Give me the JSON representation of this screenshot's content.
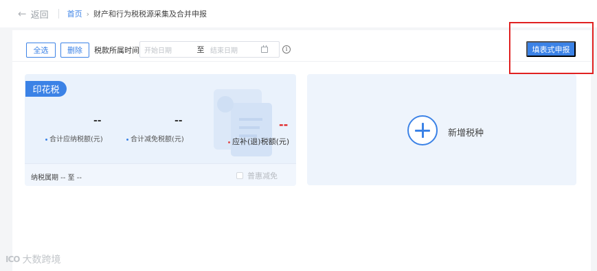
{
  "topbar": {
    "back_label": "返回",
    "breadcrumb": {
      "home": "首页",
      "separator": "›",
      "current": "财产和行为税税源采集及合并申报"
    }
  },
  "toolbar": {
    "select_all_label": "全选",
    "delete_label": "删除",
    "period_label": "税款所属时间",
    "date_start_placeholder": "开始日期",
    "date_to": "至",
    "date_end_placeholder": "结束日期",
    "info_glyph": "i",
    "fill_form_label": "填表式申报"
  },
  "tax_card": {
    "tag": "印花税",
    "stats": [
      {
        "value": "--",
        "label": "合计应纳税额(元)"
      },
      {
        "value": "--",
        "label": "合计减免税额(元)"
      },
      {
        "value": "--",
        "label": "应补(退)税额(元)"
      }
    ],
    "footer": {
      "period_text": "纳税属期 -- 至 --",
      "relief_label": "普惠减免"
    }
  },
  "add_card": {
    "label": "新增税种"
  },
  "watermark": {
    "logo": "ICO",
    "text": "大数跨境"
  },
  "colors": {
    "accent": "#3b82e6",
    "highlight_box": "#e02020",
    "negative_value": "#e02020"
  }
}
